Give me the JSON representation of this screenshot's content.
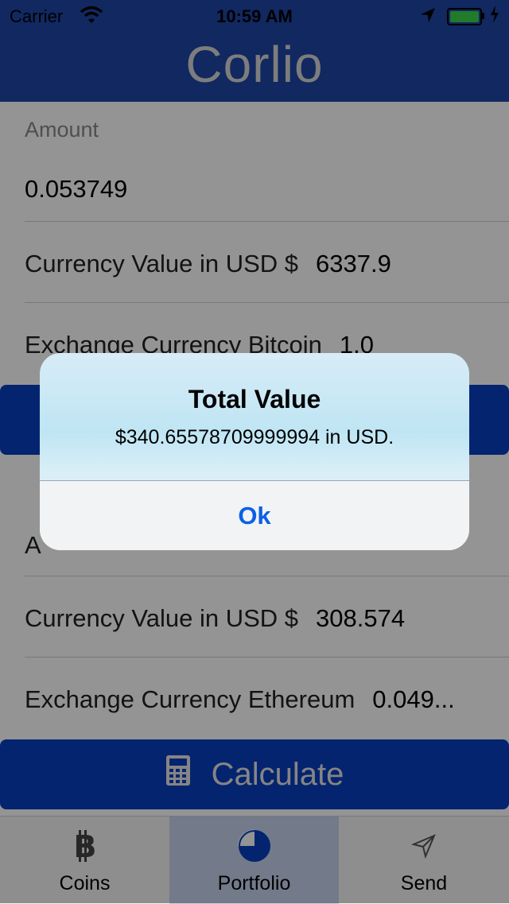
{
  "status_bar": {
    "carrier": "Carrier",
    "time": "10:59 AM"
  },
  "nav": {
    "title": "Corlio"
  },
  "bitcoin_section": {
    "amount_label": "Amount",
    "amount_value": "0.053749",
    "usd_label": "Currency Value in USD $",
    "usd_value": "6337.9",
    "exchange_label": "Exchange Currency Bitcoin",
    "exchange_value": "1.0"
  },
  "ethereum_section": {
    "amount_label_partial": "A",
    "usd_label": "Currency Value in USD $",
    "usd_value": "308.574",
    "exchange_label": "Exchange Currency Ethereum",
    "exchange_value": "0.049..."
  },
  "calculate_button": {
    "label": "Calculate",
    "icon": "calculator-icon"
  },
  "tabs": [
    {
      "label": "Coins",
      "icon": "bitcoin-icon",
      "selected": false
    },
    {
      "label": "Portfolio",
      "icon": "pie-chart-icon",
      "selected": true
    },
    {
      "label": "Send",
      "icon": "send-icon",
      "selected": false
    }
  ],
  "alert": {
    "title": "Total Value",
    "message": "$340.65578709999994 in USD.",
    "ok_label": "Ok"
  },
  "colors": {
    "nav_bg": "#1e45a6",
    "button_bg": "#0a3fc0",
    "alert_button_text": "#0a60e6"
  }
}
